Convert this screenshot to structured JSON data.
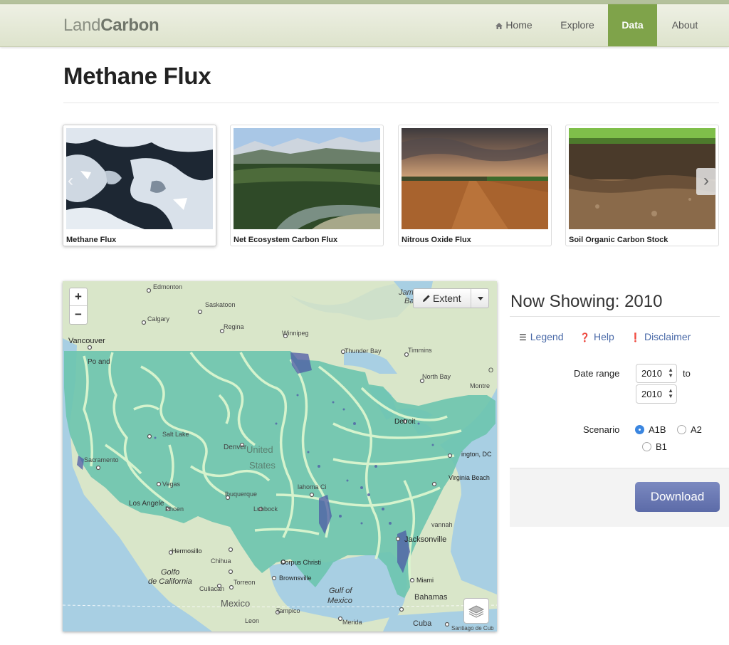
{
  "brand": {
    "light": "Land",
    "bold": "Carbon"
  },
  "nav": {
    "home": "Home",
    "explore": "Explore",
    "data": "Data",
    "about": "About"
  },
  "page": {
    "title": "Methane Flux"
  },
  "carousel": {
    "items": [
      {
        "caption": "Methane Flux"
      },
      {
        "caption": "Net Ecosystem Carbon Flux"
      },
      {
        "caption": "Nitrous Oxide Flux"
      },
      {
        "caption": "Soil Organic Carbon Stock"
      }
    ]
  },
  "map": {
    "zoom_in": "+",
    "zoom_out": "−",
    "extent_label": "Extent",
    "labels": {
      "edmonton": "Edmonton",
      "saskatoon": "Saskatoon",
      "calgary": "Calgary",
      "regina": "Regina",
      "vancouver": "Vancouver",
      "winnipeg": "Winnipeg",
      "thunder_bay": "Thunder Bay",
      "timmins": "Timmins",
      "north_bay": "North Bay",
      "montreal": "Montre",
      "ottawa": "O",
      "james": "Jam",
      "ba": "Ba",
      "portland": "Po  and",
      "salt_lake": "Salt Lake",
      "denver": "Denver",
      "united": "United",
      "states": "States",
      "detroit": "Detroit",
      "washington": "ington, DC",
      "virginia_beach": "Virginia Beach",
      "sacramento": "Sacramento",
      "las_vegas": "Vegas",
      "los_angeles": "Los Angele",
      "phoenix": "Phoen",
      "albuquerque": "lbuquerque",
      "lubbock": "Lubbock",
      "jacksonville": "Jacksonville",
      "hermosillo": "Hermosillo",
      "chihuahua": "Chihua",
      "golfo": "Golfo",
      "de_california": "de California",
      "culiacan": "Culiacan",
      "torreon": "Torreon",
      "corpus_christi": "Corpus Christi",
      "brownsville": "Brownsville",
      "gulf": "Gulf of",
      "mexico_gulf": "Mexico",
      "mexico": "Mexico",
      "tampico": "Tampico",
      "leon": "Leon",
      "merida": "Merida",
      "miami": "Miami",
      "bahamas": "Bahamas",
      "savannah": "vannah",
      "cuba": "Cuba",
      "santiago": "Santiago de Cub",
      "oklahoma": "lahoma Ci"
    }
  },
  "panel": {
    "title": "Now Showing: 2010",
    "legend": "Legend",
    "help": "Help",
    "disclaimer": "Disclaimer",
    "date_range_label": "Date range",
    "date_from": "2010",
    "to_label": "to",
    "date_to": "2010",
    "scenario_label": "Scenario",
    "scenarios": [
      "A1B",
      "A2",
      "B1"
    ],
    "selected_scenario": "A1B",
    "download": "Download"
  },
  "colors": {
    "nav_active": "#7fa34a",
    "download": "#6675b3",
    "link": "#4a6aa8",
    "overlay": "#6cc4ae",
    "region_edge": "#ddf5cf"
  }
}
